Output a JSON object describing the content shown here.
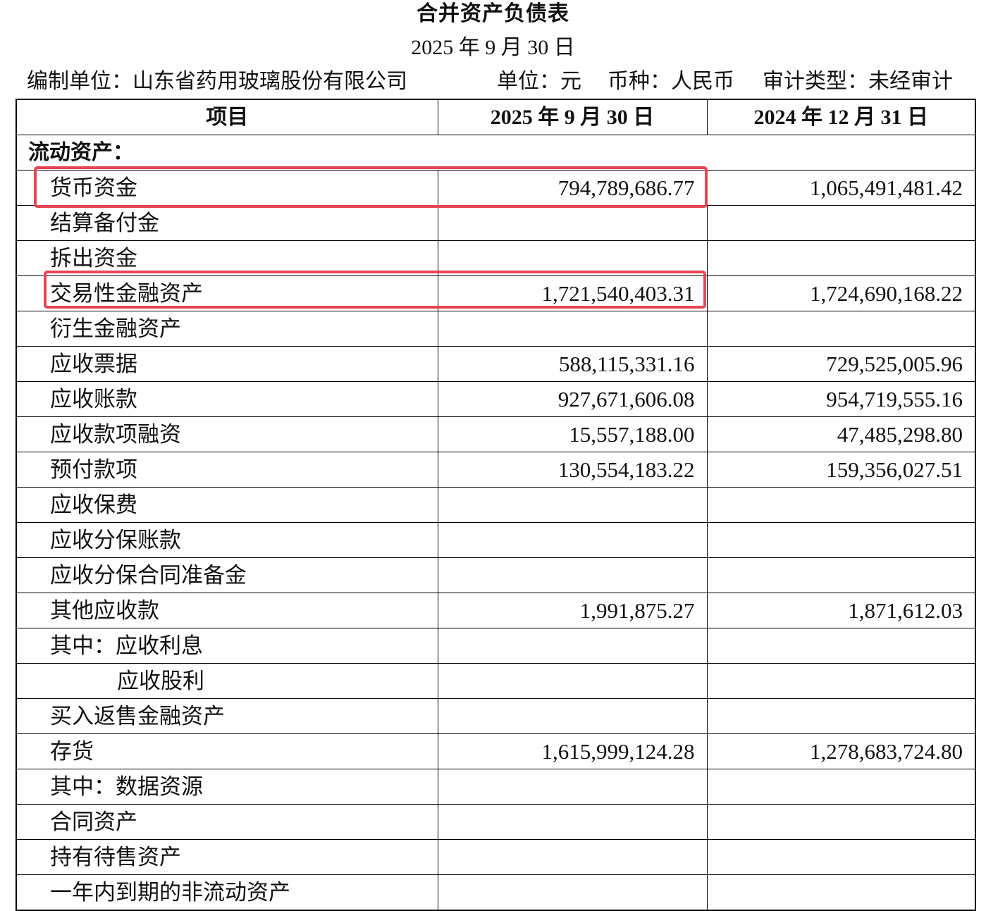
{
  "title": "合并资产负债表",
  "date": "2025 年 9 月 30 日",
  "info": {
    "preparer": "编制单位：山东省药用玻璃股份有限公司",
    "unit": "单位：元",
    "currency": "币种：人民币",
    "audit_type": "审计类型：未经审计"
  },
  "table": {
    "headers": [
      "项目",
      "2025 年 9 月 30 日",
      "2024 年 12 月 31 日"
    ],
    "section": "流动资产：",
    "rows": [
      {
        "item": "货币资金",
        "current": "794,789,686.77",
        "previous": "1,065,491,481.42"
      },
      {
        "item": "结算备付金"
      },
      {
        "item": "拆出资金"
      },
      {
        "item": "交易性金融资产",
        "current": "1,721,540,403.31",
        "previous": "1,724,690,168.22"
      },
      {
        "item": "衍生金融资产"
      },
      {
        "item": "应收票据",
        "current": "588,115,331.16",
        "previous": "729,525,005.96"
      },
      {
        "item": "应收账款",
        "current": "927,671,606.08",
        "previous": "954,719,555.16"
      },
      {
        "item": "应收款项融资",
        "current": "15,557,188.00",
        "previous": "47,485,298.80"
      },
      {
        "item": "预付款项",
        "current": "130,554,183.22",
        "previous": "159,356,027.51"
      },
      {
        "item": "应收保费"
      },
      {
        "item": "应收分保账款"
      },
      {
        "item": "应收分保合同准备金"
      },
      {
        "item": "其他应收款",
        "current": "1,991,875.27",
        "previous": "1,871,612.03"
      },
      {
        "item": "其中：应收利息"
      },
      {
        "item": "应收股利"
      },
      {
        "item": "买入返售金融资产"
      },
      {
        "item": "存货",
        "current": "1,615,999,124.28",
        "previous": "1,278,683,724.80"
      },
      {
        "item": "其中：数据资源"
      },
      {
        "item": "合同资产"
      },
      {
        "item": "持有待售资产"
      },
      {
        "item": "一年内到期的非流动资产"
      }
    ]
  },
  "highlight_color": "#e64553"
}
